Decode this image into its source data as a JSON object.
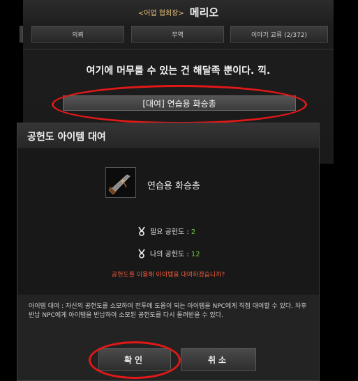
{
  "npc": {
    "subtitle": "<어업 협회장>",
    "name": "메리오",
    "tabs": [
      {
        "label": "의뢰"
      },
      {
        "label": "무역"
      },
      {
        "label": "이야기 교류 (2/372)"
      }
    ],
    "message": "여기에 머무를 수 있는 건 해달족 뿐이다. 끽.",
    "option_label": "[대여] 연습용 화승총"
  },
  "modal": {
    "title": "공헌도 아이템 대여",
    "item_name": "연습용 화승총",
    "item_icon": "matchlock-gun-icon",
    "required_label": "필요 공헌도 : ",
    "required_value": "2",
    "mine_label": "나의 공헌도 : ",
    "mine_value": "12",
    "confirm_question": "공헌도를 이용해 아이템을 대여하겠습니까?",
    "description": "아이템 대여 : 자신의 공헌도를 소모하여 전투에 도움이 되는 아이템을 NPC에게 직접 대여할 수 있다. 차후 반납 NPC에게 아이템을 반납하여 소모된 공헌도를 다시 돌려받을 수 있다.",
    "ok_label": "확인",
    "cancel_label": "취소"
  },
  "colors": {
    "accent_green": "#6fcf3a",
    "warning_red": "#f05a3c",
    "highlight_ring": "#e01818"
  }
}
